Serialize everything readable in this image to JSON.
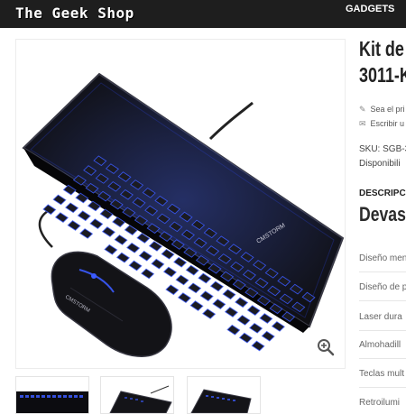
{
  "header": {
    "logo": "The Geek Shop",
    "nav_item": "GADGETS"
  },
  "product": {
    "title_line1": "Kit de",
    "title_line2": "3011-K",
    "review_first": "Sea el pri",
    "review_write": "Escribir u",
    "sku": "SKU: SGB-3",
    "availability": "Disponibili",
    "description_heading": "DESCRIPC",
    "subtitle": "Devas",
    "features": [
      "Diseño men",
      "Diseño de p",
      "Laser dura",
      "Almohadill",
      "Teclas mult",
      "Retroilumi"
    ]
  },
  "gallery": {
    "keyboard_brand": "CMSTORM",
    "mouse_brand": "CMSTORM",
    "zoom_icon": "zoom-in-icon",
    "thumbnail_count": 3,
    "colors": {
      "backlight": "#3b5bff",
      "device": "#161616"
    }
  }
}
